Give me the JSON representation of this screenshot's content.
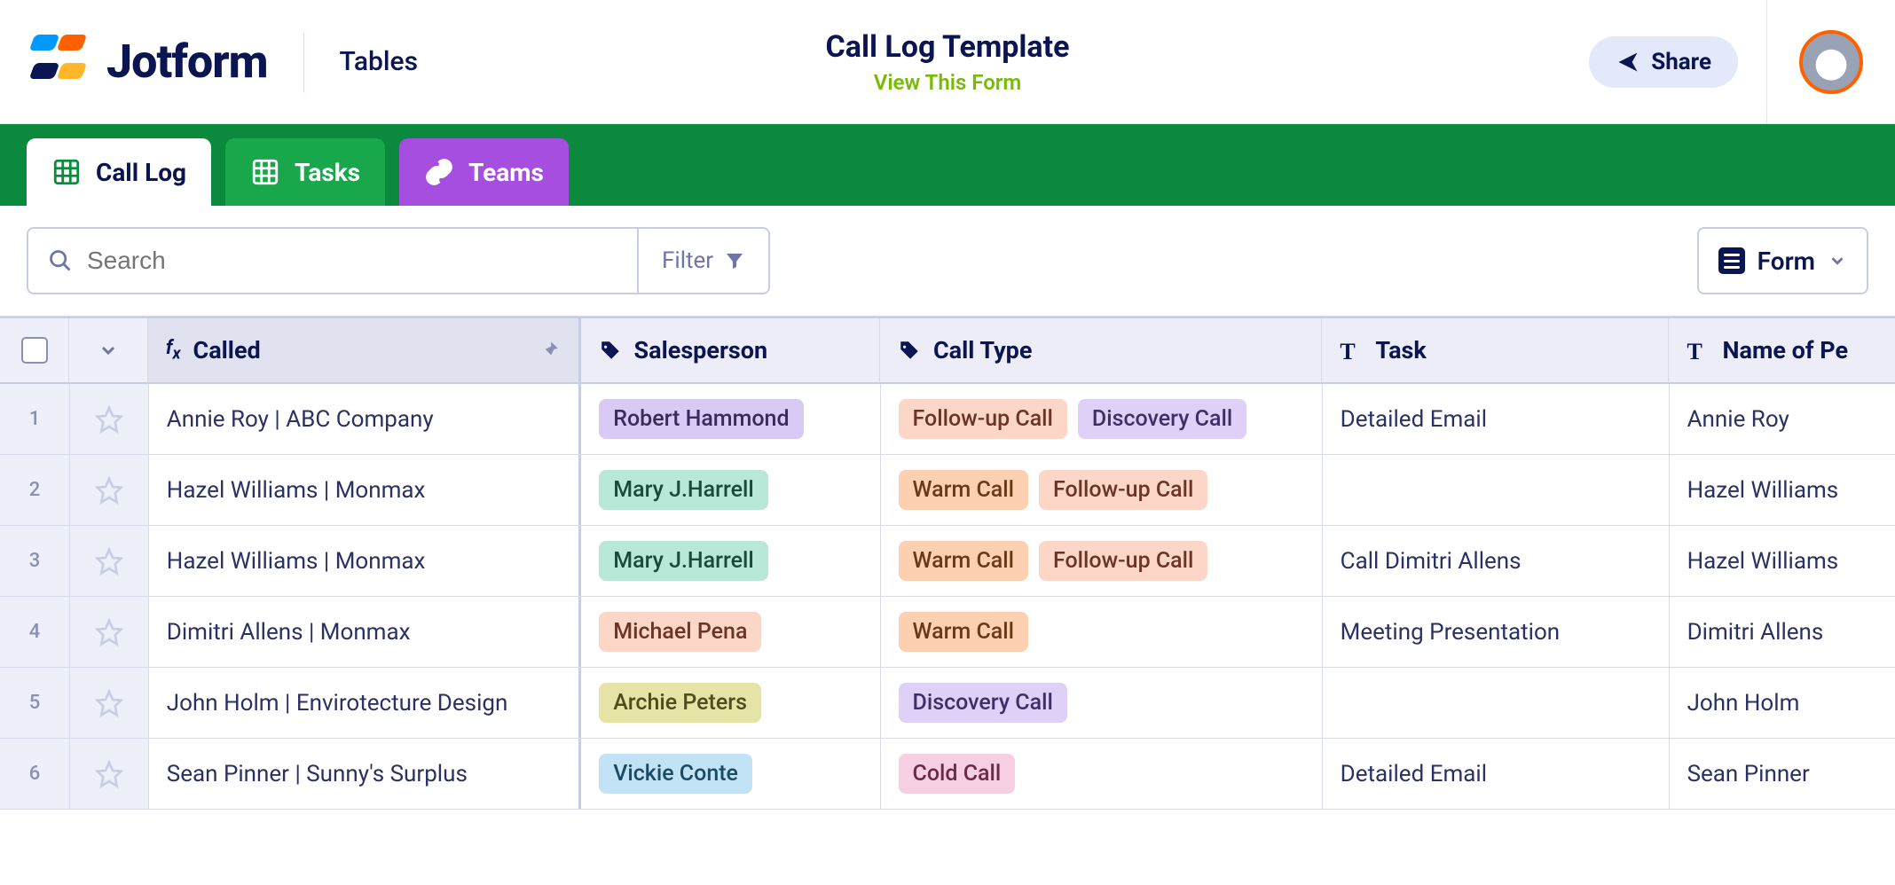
{
  "header": {
    "brand": "Jotform",
    "product": "Tables",
    "title": "Call Log Template",
    "view_link": "View This Form",
    "share_label": "Share"
  },
  "tabs": [
    {
      "label": "Call Log",
      "kind": "active"
    },
    {
      "label": "Tasks",
      "kind": "green"
    },
    {
      "label": "Teams",
      "kind": "purple"
    }
  ],
  "toolbar": {
    "search_placeholder": "Search",
    "filter_label": "Filter",
    "view_button_label": "Form"
  },
  "columns": {
    "called": "Called",
    "salesperson": "Salesperson",
    "call_type": "Call Type",
    "task": "Task",
    "name": "Name of Pe"
  },
  "rows": [
    {
      "num": "1",
      "called": "Annie Roy | ABC Company",
      "sales": {
        "label": "Robert Hammond",
        "color": "purple"
      },
      "types": [
        {
          "label": "Follow-up Call",
          "color": "peach"
        },
        {
          "label": "Discovery Call",
          "color": "lav"
        }
      ],
      "task": "Detailed Email",
      "name": "Annie Roy"
    },
    {
      "num": "2",
      "called": "Hazel Williams | Monmax",
      "sales": {
        "label": "Mary J.Harrell",
        "color": "teal"
      },
      "types": [
        {
          "label": "Warm Call",
          "color": "orange"
        },
        {
          "label": "Follow-up Call",
          "color": "peach"
        }
      ],
      "task": "",
      "name": "Hazel Williams"
    },
    {
      "num": "3",
      "called": "Hazel Williams | Monmax",
      "sales": {
        "label": "Mary J.Harrell",
        "color": "teal"
      },
      "types": [
        {
          "label": "Warm Call",
          "color": "orange"
        },
        {
          "label": "Follow-up Call",
          "color": "peach"
        }
      ],
      "task": "Call Dimitri Allens",
      "name": "Hazel Williams"
    },
    {
      "num": "4",
      "called": "Dimitri Allens | Monmax",
      "sales": {
        "label": "Michael Pena",
        "color": "peach"
      },
      "types": [
        {
          "label": "Warm Call",
          "color": "orange"
        }
      ],
      "task": "Meeting Presentation",
      "name": "Dimitri Allens"
    },
    {
      "num": "5",
      "called": "John Holm | Envirotecture Design",
      "sales": {
        "label": "Archie Peters",
        "color": "yellow"
      },
      "types": [
        {
          "label": "Discovery Call",
          "color": "lav"
        }
      ],
      "task": "",
      "name": "John Holm"
    },
    {
      "num": "6",
      "called": "Sean Pinner | Sunny's Surplus",
      "sales": {
        "label": "Vickie Conte",
        "color": "blue"
      },
      "types": [
        {
          "label": "Cold Call",
          "color": "pink"
        }
      ],
      "task": "Detailed Email",
      "name": "Sean Pinner"
    }
  ]
}
